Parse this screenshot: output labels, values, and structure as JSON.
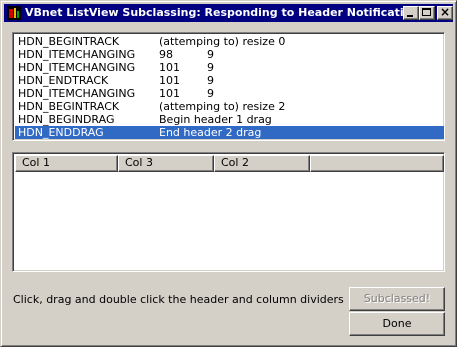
{
  "window": {
    "title": "VBnet ListView Subclassing: Responding to Header Notifications",
    "app_icon": "vb-app-icon",
    "caption_buttons": {
      "minimize_icon": "minimize-icon",
      "maximize_icon": "maximize-icon",
      "close_glyph": "×"
    }
  },
  "log": {
    "rows": [
      {
        "msg": "HDN_BEGINTRACK",
        "a": "(attemping to) resize 0",
        "b": ""
      },
      {
        "msg": "HDN_ITEMCHANGING",
        "a": "98",
        "b": "9"
      },
      {
        "msg": "HDN_ITEMCHANGING",
        "a": "101",
        "b": "9"
      },
      {
        "msg": "HDN_ENDTRACK",
        "a": "101",
        "b": "9"
      },
      {
        "msg": "HDN_ITEMCHANGING",
        "a": "101",
        "b": "9"
      },
      {
        "msg": "HDN_BEGINTRACK",
        "a": "(attemping to) resize 2",
        "b": ""
      },
      {
        "msg": "HDN_BEGINDRAG",
        "a": "Begin header 1 drag",
        "b": ""
      },
      {
        "msg": "HDN_ENDDRAG",
        "a": "End header 2 drag",
        "b": ""
      }
    ],
    "selected_index": 7
  },
  "listview": {
    "columns": [
      "Col 1",
      "Col 3",
      "Col 2",
      ""
    ]
  },
  "footer": {
    "instructions": "Click, drag and double click the header and column dividers",
    "subclassed_label": "Subclassed!",
    "done_label": "Done"
  },
  "colors": {
    "titlebar": "#000080",
    "selection": "#316ac5",
    "face": "#d4d0c8"
  }
}
